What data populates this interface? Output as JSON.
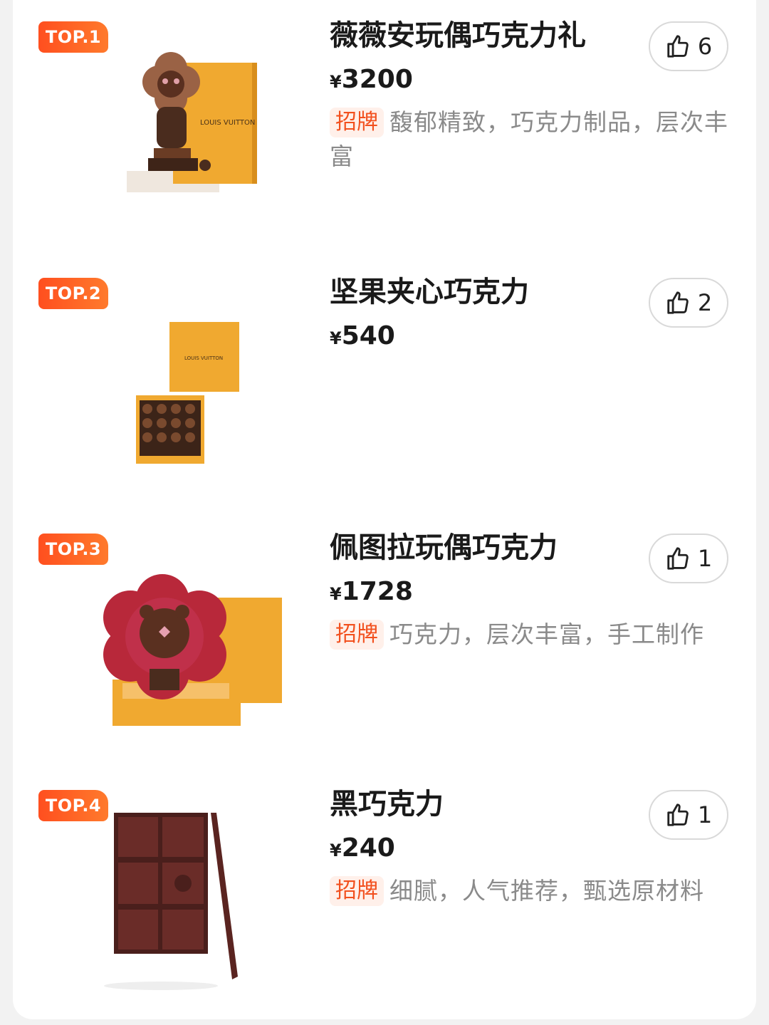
{
  "items": [
    {
      "rank": "TOP.1",
      "name": "薇薇安玩偶巧克力礼",
      "currency": "¥",
      "price": "3200",
      "tag": "招牌",
      "desc": "馥郁精致，巧克力制品，层次丰富",
      "likes": "6",
      "box_text": "LOUIS VUITTON",
      "image_icon": "chocolate-doll-gift-box"
    },
    {
      "rank": "TOP.2",
      "name": "坚果夹心巧克力",
      "currency": "¥",
      "price": "540",
      "tag": "",
      "desc": "",
      "likes": "2",
      "box_text": "LOUIS VUITTON",
      "image_icon": "praline-chocolate-box"
    },
    {
      "rank": "TOP.3",
      "name": "佩图拉玩偶巧克力",
      "currency": "¥",
      "price": "1728",
      "tag": "招牌",
      "desc": "巧克力，层次丰富，手工制作",
      "likes": "1",
      "image_icon": "flower-chocolate-doll"
    },
    {
      "rank": "TOP.4",
      "name": "黑巧克力",
      "currency": "¥",
      "price": "240",
      "tag": "招牌",
      "desc": "细腻，人气推荐，甄选原材料",
      "likes": "1",
      "image_icon": "dark-chocolate-bar"
    }
  ],
  "colors": {
    "badge": "#ff5a22",
    "tag_text": "#f2501e",
    "tag_bg": "#fff0ea",
    "box_orange": "#f2a52a"
  }
}
